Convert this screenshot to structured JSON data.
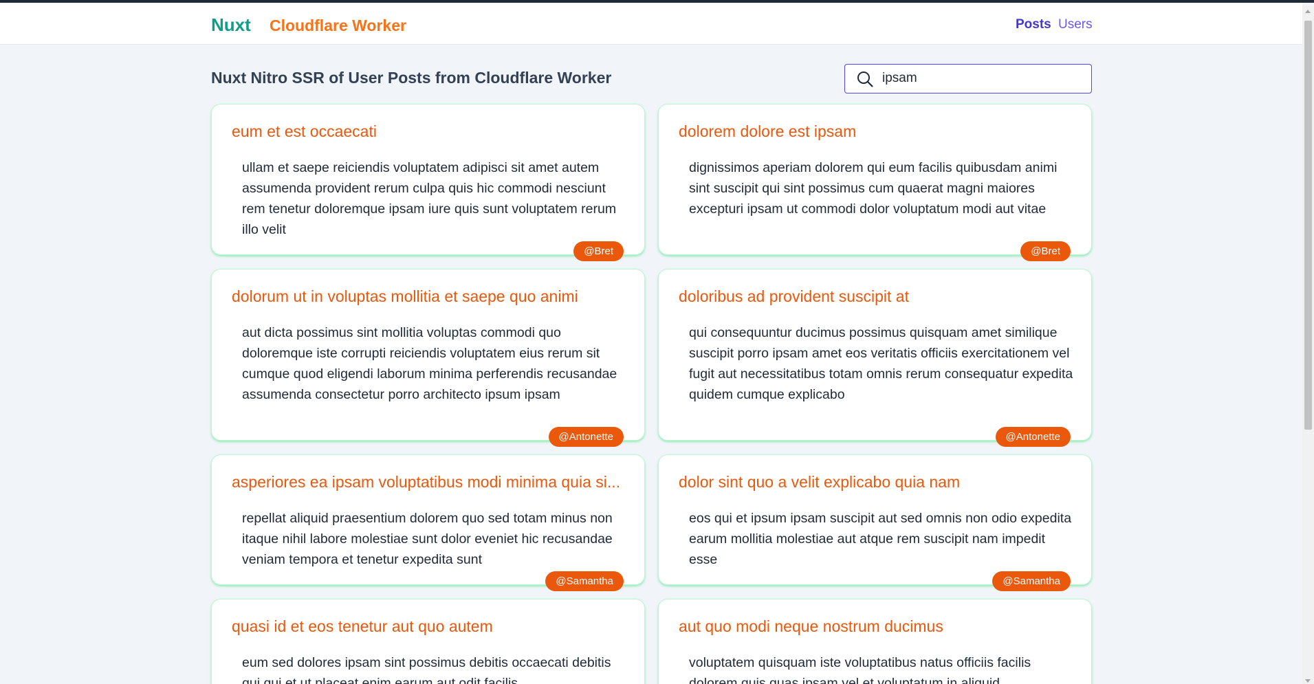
{
  "header": {
    "brand": "Nuxt",
    "brand_sub": "Cloudflare Worker",
    "nav": [
      {
        "label": "Posts"
      },
      {
        "label": "Users"
      }
    ]
  },
  "page": {
    "title": "Nuxt Nitro SSR of User Posts from Cloudflare Worker"
  },
  "search": {
    "value": "ipsam",
    "icon": "search-icon"
  },
  "posts": [
    {
      "title": "eum et est occaecati",
      "body": "ullam et saepe reiciendis voluptatem adipisci sit amet autem assumenda provident rerum culpa quis hic commodi nesciunt rem tenetur doloremque ipsam iure quis sunt voluptatem rerum illo velit",
      "user": "@Bret"
    },
    {
      "title": "dolorem dolore est ipsam",
      "body": "dignissimos aperiam dolorem qui eum facilis quibusdam animi sint suscipit qui sint possimus cum quaerat magni maiores excepturi ipsam ut commodi dolor voluptatum modi aut vitae",
      "user": "@Bret"
    },
    {
      "title": "dolorum ut in voluptas mollitia et saepe quo animi",
      "body": "aut dicta possimus sint mollitia voluptas commodi quo doloremque iste corrupti reiciendis voluptatem eius rerum sit cumque quod eligendi laborum minima perferendis recusandae assumenda consectetur porro architecto ipsum ipsam",
      "user": "@Antonette"
    },
    {
      "title": "doloribus ad provident suscipit at",
      "body": "qui consequuntur ducimus possimus quisquam amet similique suscipit porro ipsam amet eos veritatis officiis exercitationem vel fugit aut necessitatibus totam omnis rerum consequatur expedita quidem cumque explicabo",
      "user": "@Antonette"
    },
    {
      "title": "asperiores ea ipsam voluptatibus modi minima quia si...",
      "body": "repellat aliquid praesentium dolorem quo sed totam minus non itaque nihil labore molestiae sunt dolor eveniet hic recusandae veniam tempora et tenetur expedita sunt",
      "user": "@Samantha"
    },
    {
      "title": "dolor sint quo a velit explicabo quia nam",
      "body": "eos qui et ipsum ipsam suscipit aut sed omnis non odio expedita earum mollitia molestiae aut atque rem suscipit nam impedit esse",
      "user": "@Samantha"
    },
    {
      "title": "quasi id et eos tenetur aut quo autem",
      "body": "eum sed dolores ipsam sint possimus debitis occaecati debitis qui qui et ut placeat enim earum aut odit facilis",
      "user": ""
    },
    {
      "title": "aut quo modi neque nostrum ducimus",
      "body": "voluptatem quisquam iste voluptatibus natus officiis facilis dolorem quis quas ipsam vel et voluptatum in aliquid",
      "user": ""
    }
  ],
  "colors": {
    "brand": "#0f9f86",
    "accent": "#ea580c",
    "nav_active": "#4338ca",
    "card_border": "#bbf7d0"
  }
}
